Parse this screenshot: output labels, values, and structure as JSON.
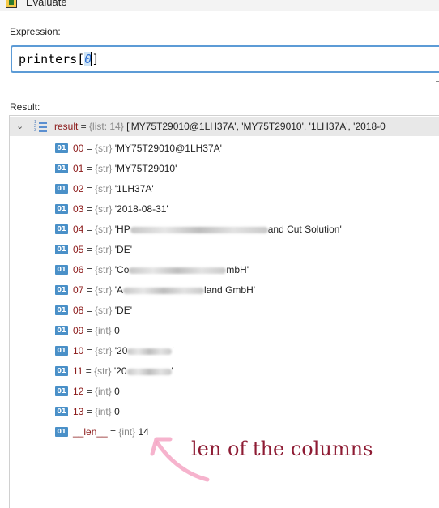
{
  "window": {
    "title": "Evaluate"
  },
  "expression": {
    "label": "Expression:",
    "prefix": "printers[",
    "selected": "0",
    "suffix": "]"
  },
  "result": {
    "label": "Result:",
    "root": {
      "name": "result",
      "eq": " = ",
      "type": "{list: 14}",
      "value": " ['MY75T29010@1LH37A', 'MY75T29010', '1LH37A', '2018-0"
    },
    "items": [
      {
        "name": "00",
        "type": "{str}",
        "value": "'MY75T29010@1LH37A'"
      },
      {
        "name": "01",
        "type": "{str}",
        "value": "'MY75T29010'"
      },
      {
        "name": "02",
        "type": "{str}",
        "value": "'1LH37A'"
      },
      {
        "name": "03",
        "type": "{str}",
        "value": "'2018-08-31'"
      },
      {
        "name": "04",
        "type": "{str}",
        "value": "'HP",
        "blur_width": 170,
        "tail": "and Cut Solution'"
      },
      {
        "name": "05",
        "type": "{str}",
        "value": "'DE'"
      },
      {
        "name": "06",
        "type": "{str}",
        "value": "'Co",
        "blur_width": 120,
        "tail": "mbH'"
      },
      {
        "name": "07",
        "type": "{str}",
        "value": "'A",
        "blur_width": 100,
        "tail": "land GmbH'"
      },
      {
        "name": "08",
        "type": "{str}",
        "value": "'DE'"
      },
      {
        "name": "09",
        "type": "{int}",
        "value": "0"
      },
      {
        "name": "10",
        "type": "{str}",
        "value": "'20",
        "blur_width": 55,
        "tail": "'"
      },
      {
        "name": "11",
        "type": "{str}",
        "value": "'20",
        "blur_width": 55,
        "tail": "'"
      },
      {
        "name": "12",
        "type": "{int}",
        "value": "0"
      },
      {
        "name": "13",
        "type": "{int}",
        "value": "0"
      },
      {
        "name": "__len__",
        "type": "{int}",
        "value": "14"
      }
    ]
  },
  "badge_label": "01",
  "annotation": {
    "text": "len of the columns",
    "color": "#8e1c34",
    "arrow_color": "#f4a6c4"
  },
  "colors": {
    "focus_border": "#5c9bd6",
    "badge": "#4a90c8",
    "var_name": "#8b1a1a",
    "root_row_bg": "#e8e8e8"
  }
}
